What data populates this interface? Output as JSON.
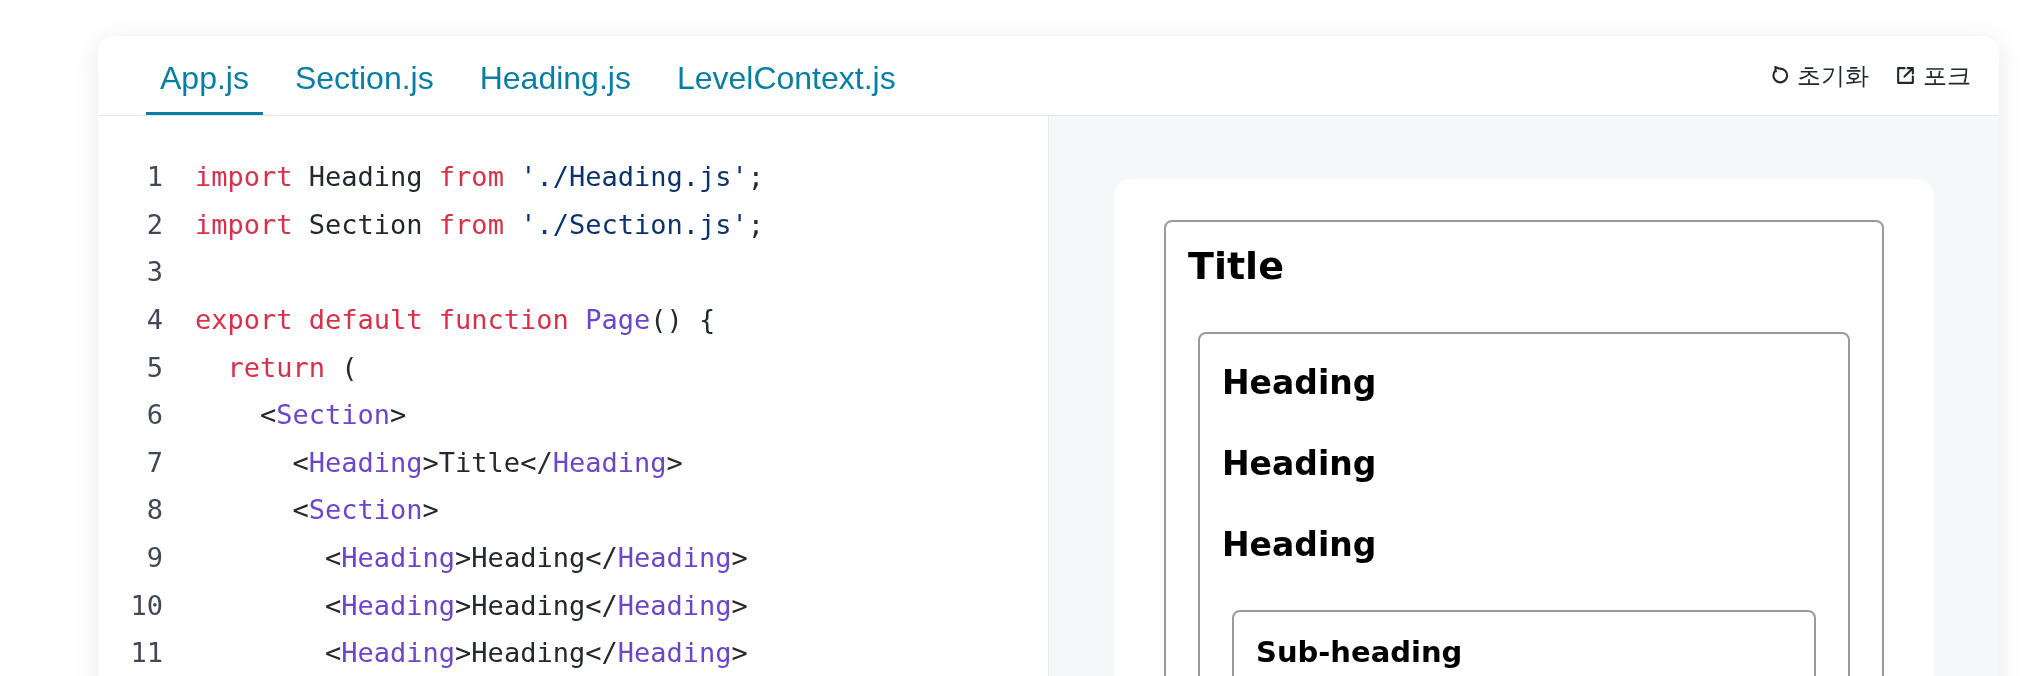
{
  "tabs": [
    {
      "label": "App.js",
      "selected": true
    },
    {
      "label": "Section.js",
      "selected": false
    },
    {
      "label": "Heading.js",
      "selected": false
    },
    {
      "label": "LevelContext.js",
      "selected": false
    }
  ],
  "actions": [
    {
      "kind": "reset",
      "label": "초기화"
    },
    {
      "kind": "fork",
      "label": "포크"
    }
  ],
  "code_lines": [
    {
      "number": "1",
      "tokens": [
        {
          "kind": "keyword",
          "text": "import"
        },
        {
          "kind": "plain",
          "text": " Heading "
        },
        {
          "kind": "keyword",
          "text": "from"
        },
        {
          "kind": "string",
          "text": " './Heading.js'"
        },
        {
          "kind": "plain",
          "text": ";"
        }
      ]
    },
    {
      "number": "2",
      "tokens": [
        {
          "kind": "keyword",
          "text": "import"
        },
        {
          "kind": "plain",
          "text": " Section "
        },
        {
          "kind": "keyword",
          "text": "from"
        },
        {
          "kind": "string",
          "text": " './Section.js'"
        },
        {
          "kind": "plain",
          "text": ";"
        }
      ]
    },
    {
      "number": "3"
    },
    {
      "number": "4",
      "tokens": [
        {
          "kind": "keyword",
          "text": "export default function"
        },
        {
          "kind": "name",
          "text": " Page"
        },
        {
          "kind": "plain",
          "text": "() {"
        }
      ]
    },
    {
      "number": "5",
      "tokens": [
        {
          "kind": "keyword",
          "text": "  return"
        },
        {
          "kind": "plain",
          "text": " ("
        }
      ]
    },
    {
      "number": "6",
      "tokens": [
        {
          "kind": "plain",
          "text": "    <"
        },
        {
          "kind": "name",
          "text": "Section"
        },
        {
          "kind": "plain",
          "text": ">"
        }
      ]
    },
    {
      "number": "7",
      "tokens": [
        {
          "kind": "plain",
          "text": "      <"
        },
        {
          "kind": "name",
          "text": "Heading"
        },
        {
          "kind": "plain",
          "text": ">Title</"
        },
        {
          "kind": "name",
          "text": "Heading"
        },
        {
          "kind": "plain",
          "text": ">"
        }
      ]
    },
    {
      "number": "8",
      "tokens": [
        {
          "kind": "plain",
          "text": "      <"
        },
        {
          "kind": "name",
          "text": "Section"
        },
        {
          "kind": "plain",
          "text": ">"
        }
      ]
    },
    {
      "number": "9",
      "tokens": [
        {
          "kind": "plain",
          "text": "        <"
        },
        {
          "kind": "name",
          "text": "Heading"
        },
        {
          "kind": "plain",
          "text": ">Heading</"
        },
        {
          "kind": "name",
          "text": "Heading"
        },
        {
          "kind": "plain",
          "text": ">"
        }
      ]
    },
    {
      "number": "10",
      "tokens": [
        {
          "kind": "plain",
          "text": "        <"
        },
        {
          "kind": "name",
          "text": "Heading"
        },
        {
          "kind": "plain",
          "text": ">Heading</"
        },
        {
          "kind": "name",
          "text": "Heading"
        },
        {
          "kind": "plain",
          "text": ">"
        }
      ]
    },
    {
      "number": "11",
      "tokens": [
        {
          "kind": "plain",
          "text": "        <"
        },
        {
          "kind": "name",
          "text": "Heading"
        },
        {
          "kind": "plain",
          "text": ">Heading</"
        },
        {
          "kind": "name",
          "text": "Heading"
        },
        {
          "kind": "plain",
          "text": ">"
        }
      ]
    }
  ],
  "preview": {
    "section": {
      "headings": [
        "Title"
      ],
      "children": [
        {
          "headings": [
            "Heading",
            "Heading",
            "Heading"
          ],
          "children": [
            {
              "headings": [
                "Sub-heading"
              ]
            }
          ]
        }
      ]
    }
  }
}
